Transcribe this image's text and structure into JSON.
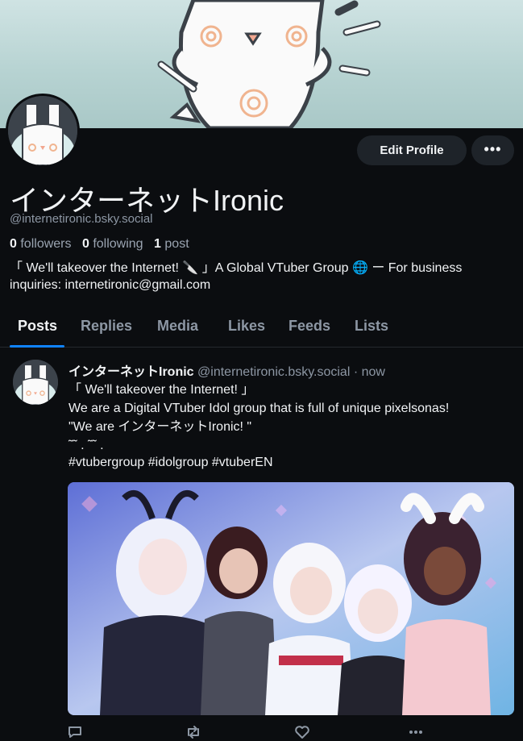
{
  "profile": {
    "display_name": "インターネットIronic",
    "handle": "@internetironic.bsky.social",
    "edit_label": "Edit Profile",
    "more_label": "•••",
    "stats": {
      "followers_count": "0",
      "followers_label": "followers",
      "following_count": "0",
      "following_label": "following",
      "posts_count": "1",
      "posts_label": "post"
    },
    "bio": "「 We'll takeover the Internet! 🔪 」A Global VTuber Group 🌐 ー  For business inquiries: internetironic@gmail.com"
  },
  "tabs": [
    {
      "label": "Posts",
      "active": true
    },
    {
      "label": "Replies",
      "active": false
    },
    {
      "label": "Media",
      "active": false
    },
    {
      "label": "Likes",
      "active": false
    },
    {
      "label": "Feeds",
      "active": false
    },
    {
      "label": "Lists",
      "active": false
    }
  ],
  "post": {
    "author": "インターネットIronic",
    "handle": "@internetironic.bsky.social",
    "time": "· now",
    "lines": [
      "「 We'll takeover the Internet! 」",
      "We are a Digital VTuber Idol group that is full of unique pixelsonas!",
      "\"We are インターネットIronic! \"",
      "˜˜ . ˜˜ ."
    ],
    "hashtags": "#vtubergroup #idolgroup #vtuberEN",
    "actions": [
      "reply-icon",
      "repost-icon",
      "like-icon",
      "more-icon"
    ]
  },
  "colors": {
    "background": "#0b0d10",
    "accent": "#1083fe",
    "muted_text": "#8d97a4",
    "button_bg": "#1e2329"
  }
}
